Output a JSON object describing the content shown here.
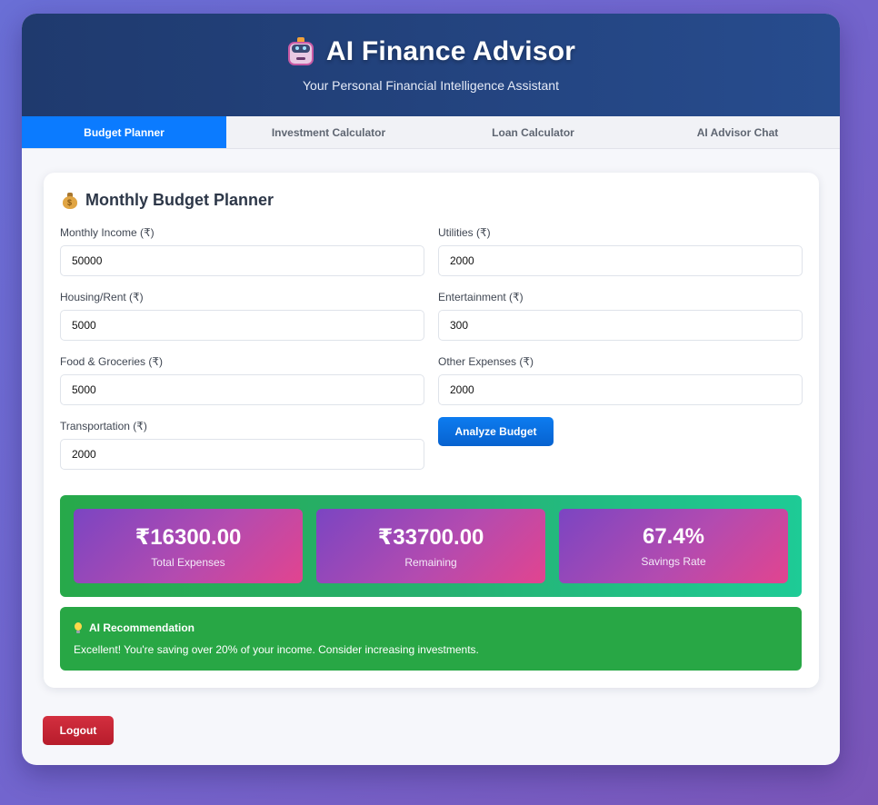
{
  "header": {
    "title": "AI Finance Advisor",
    "subtitle": "Your Personal Financial Intelligence Assistant",
    "logo_icon": "robot-icon"
  },
  "tabs": [
    {
      "label": "Budget Planner",
      "active": true
    },
    {
      "label": "Investment Calculator",
      "active": false
    },
    {
      "label": "Loan Calculator",
      "active": false
    },
    {
      "label": "AI Advisor Chat",
      "active": false
    }
  ],
  "budget": {
    "title": "Monthly Budget Planner",
    "title_icon": "money-bag-icon",
    "fields": {
      "income": {
        "label": "Monthly Income (₹)",
        "value": "50000"
      },
      "housing": {
        "label": "Housing/Rent (₹)",
        "value": "5000"
      },
      "food": {
        "label": "Food & Groceries (₹)",
        "value": "5000"
      },
      "transport": {
        "label": "Transportation (₹)",
        "value": "2000"
      },
      "utilities": {
        "label": "Utilities (₹)",
        "value": "2000"
      },
      "entertainment": {
        "label": "Entertainment (₹)",
        "value": "300"
      },
      "other": {
        "label": "Other Expenses (₹)",
        "value": "2000"
      }
    },
    "analyze_label": "Analyze Budget"
  },
  "results": {
    "total_expenses": {
      "value": "₹16300.00",
      "label": "Total Expenses"
    },
    "remaining": {
      "value": "₹33700.00",
      "label": "Remaining"
    },
    "savings_rate": {
      "value": "67.4%",
      "label": "Savings Rate"
    }
  },
  "recommendation": {
    "title": "AI Recommendation",
    "icon": "lightbulb-icon",
    "text": "Excellent! You're saving over 20% of your income. Consider increasing investments."
  },
  "logout_label": "Logout",
  "colors": {
    "header": "#1f3a6e",
    "tab_active": "#0b7bff",
    "analyze_button": "#0d7cf0",
    "stats_bg": "#27a94a",
    "stat_card_start": "#7b45c2",
    "stat_card_end": "#e2448f",
    "recommendation_bg": "#28a745",
    "logout_button": "#d32f3f"
  }
}
